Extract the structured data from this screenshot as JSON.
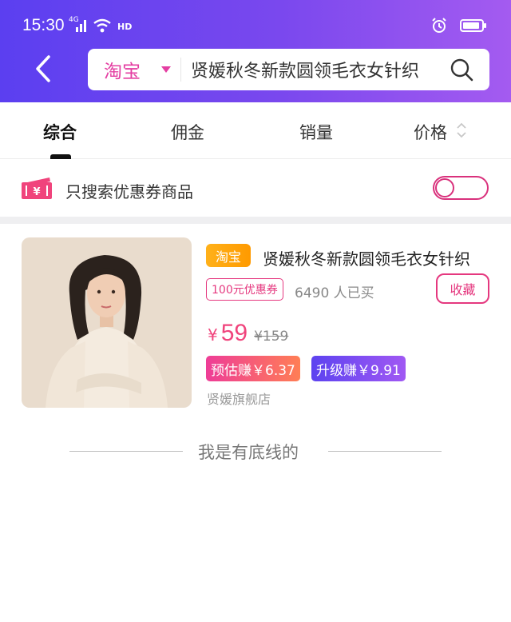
{
  "status_bar": {
    "time": "15:30",
    "network": "4G",
    "hd": "HD",
    "icons": [
      "signal-icon",
      "wifi-icon",
      "hd-icon",
      "alarm-icon",
      "battery-icon"
    ]
  },
  "search": {
    "platform": "淘宝",
    "query": "贤媛秋冬新款圆领毛衣女针织"
  },
  "tabs": [
    {
      "label": "综合",
      "active": true
    },
    {
      "label": "佣金",
      "active": false
    },
    {
      "label": "销量",
      "active": false
    },
    {
      "label": "价格",
      "active": false
    }
  ],
  "coupon_filter": {
    "icon_text": "¥",
    "label": "只搜索优惠券商品",
    "enabled": false
  },
  "product": {
    "shop_tag": "淘宝",
    "title": "贤媛秋冬新款圆领毛衣女针织",
    "coupon": "100元优惠券",
    "sales": "6490 人已买",
    "favorite_label": "收藏",
    "price_symbol": "¥",
    "price": "59",
    "original_price": "¥159",
    "earn_estimate": "预估赚￥6.37",
    "earn_upgrade": "升级赚￥9.91",
    "store": "贤媛旗舰店"
  },
  "footer": {
    "end_text": "我是有底线的"
  },
  "colors": {
    "header_start": "#5b3ff0",
    "header_end": "#a45bf0",
    "accent_pink": "#e5387f",
    "price_pink": "#f0447c",
    "tag_orange": "#ffa41a"
  }
}
